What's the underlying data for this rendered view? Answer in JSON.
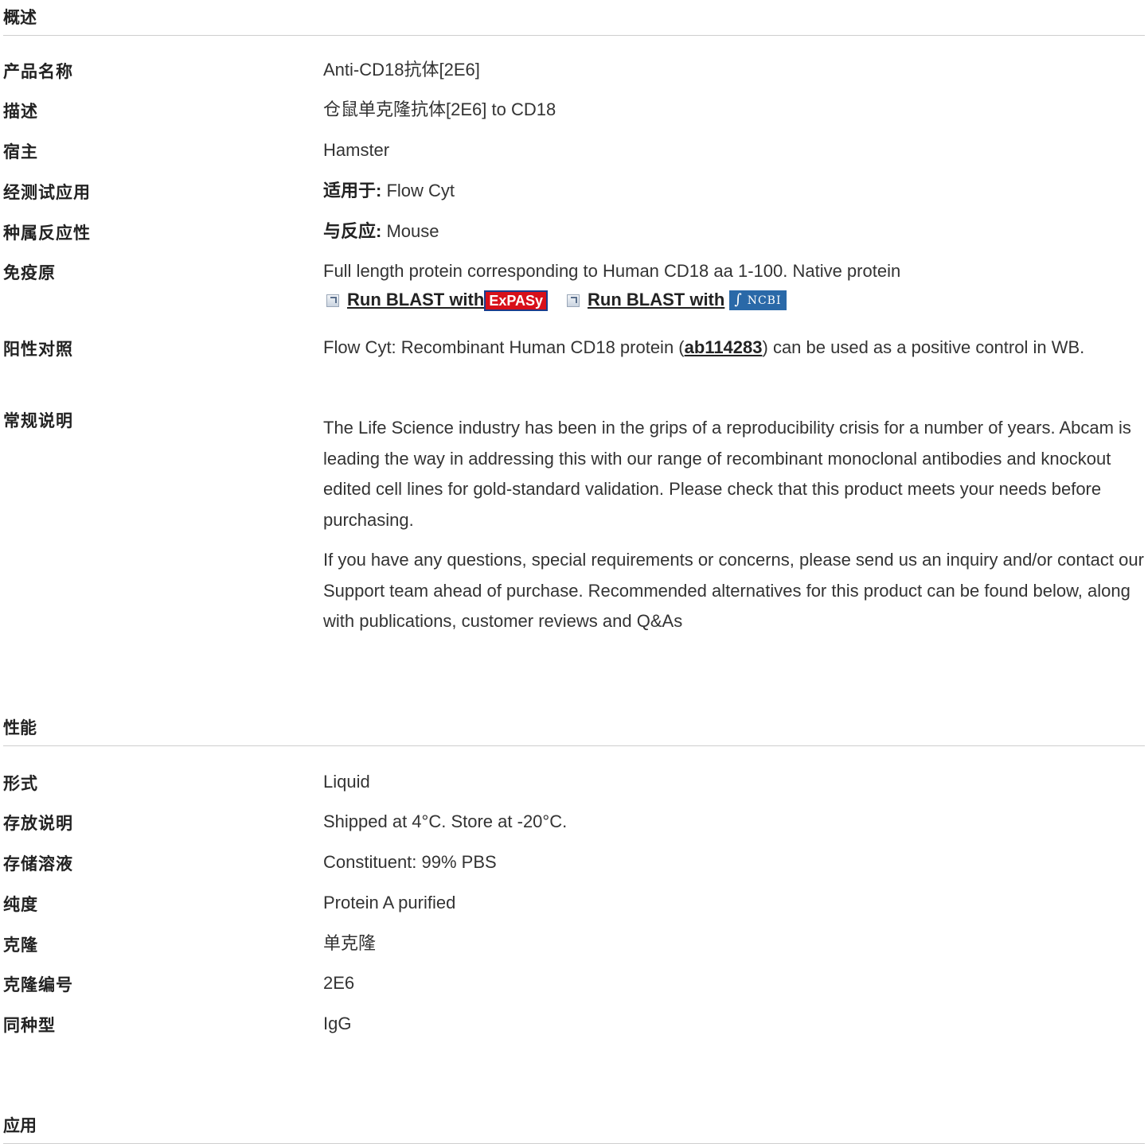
{
  "sections": {
    "overview": "概述",
    "properties": "性能",
    "applications": "应用"
  },
  "overview": {
    "product_name": {
      "label": "产品名称",
      "value": "Anti-CD18抗体[2E6]"
    },
    "description": {
      "label": "描述",
      "value": "仓鼠单克隆抗体[2E6] to CD18"
    },
    "host": {
      "label": "宿主",
      "value": "Hamster"
    },
    "tested_applications": {
      "label": "经测试应用",
      "prefix": "适用于:",
      "value": " Flow Cyt"
    },
    "species_reactivity": {
      "label": "种属反应性",
      "prefix": "与反应:",
      "value": " Mouse"
    },
    "immunogen": {
      "label": "免疫原",
      "value": "Full length protein corresponding to Human CD18 aa 1-100. Native protein",
      "blast_expasy": "Run BLAST with ",
      "expasy_logo": "ExPASy",
      "blast_ncbi": "Run BLAST with",
      "ncbi_logo": "NCBI"
    },
    "positive_control": {
      "label": "阳性对照",
      "before": "Flow Cyt: Recombinant Human CD18 protein (",
      "link": "ab114283",
      "after": ") can be used as a positive control in WB."
    },
    "general_notes": {
      "label": "常规说明",
      "p1": "The Life Science industry has been in the grips of a reproducibility crisis for a number of years. Abcam is leading the way in addressing this with our range of recombinant monoclonal antibodies and knockout edited cell lines for gold-standard validation. Please check that this product meets your needs before purchasing.",
      "p2": "If you have any questions, special requirements or concerns, please send us an inquiry and/or contact our Support team ahead of purchase. Recommended alternatives for this product can be found below, along with publications, customer reviews and Q&As"
    }
  },
  "properties": {
    "form": {
      "label": "形式",
      "value": "Liquid"
    },
    "storage": {
      "label": "存放说明",
      "value": "Shipped at 4°C. Store at -20°C."
    },
    "buffer": {
      "label": "存储溶液",
      "value": "Constituent: 99% PBS"
    },
    "purity": {
      "label": "纯度",
      "value": "Protein A purified"
    },
    "clonality": {
      "label": "克隆",
      "value": "单克隆"
    },
    "clone_number": {
      "label": "克隆编号",
      "value": "2E6"
    },
    "isotype": {
      "label": "同种型",
      "value": "IgG"
    }
  }
}
